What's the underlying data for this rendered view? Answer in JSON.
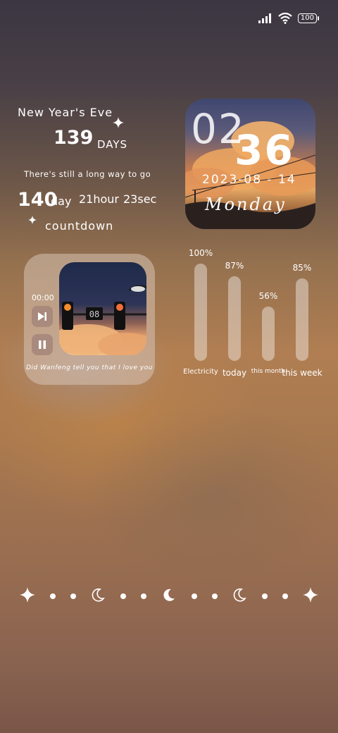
{
  "status": {
    "battery": "100"
  },
  "countdown": {
    "title": "New Year's Eve",
    "days_value": "139",
    "days_label": "DAYS",
    "subtitle": "There's still a long way to go",
    "cd_days": "140",
    "cd_day_unit": "day",
    "cd_hours": "21hour",
    "cd_secs": "23sec",
    "label": "countdown"
  },
  "clock": {
    "hour": "02",
    "minute": "36",
    "date": "2023-08 - 14",
    "weekday": "Monday"
  },
  "music": {
    "time": "00:00",
    "title": "Did Wanfeng tell you that I love you",
    "traffic_display": "08"
  },
  "stats": [
    {
      "label": "Electricity",
      "percent": "100%",
      "value": 100
    },
    {
      "label": "today",
      "percent": "87%",
      "value": 87
    },
    {
      "label": "this month",
      "percent": "56%",
      "value": 56
    },
    {
      "label": "this week",
      "percent": "85%",
      "value": 85
    }
  ],
  "dock_icons": [
    "sparkle-icon",
    "dot-icon",
    "dot-icon",
    "moon-outline-icon",
    "dot-icon",
    "dot-icon",
    "moon-solid-icon",
    "dot-icon",
    "dot-icon",
    "moon-outline-icon",
    "dot-icon",
    "dot-icon",
    "sparkle-icon"
  ]
}
